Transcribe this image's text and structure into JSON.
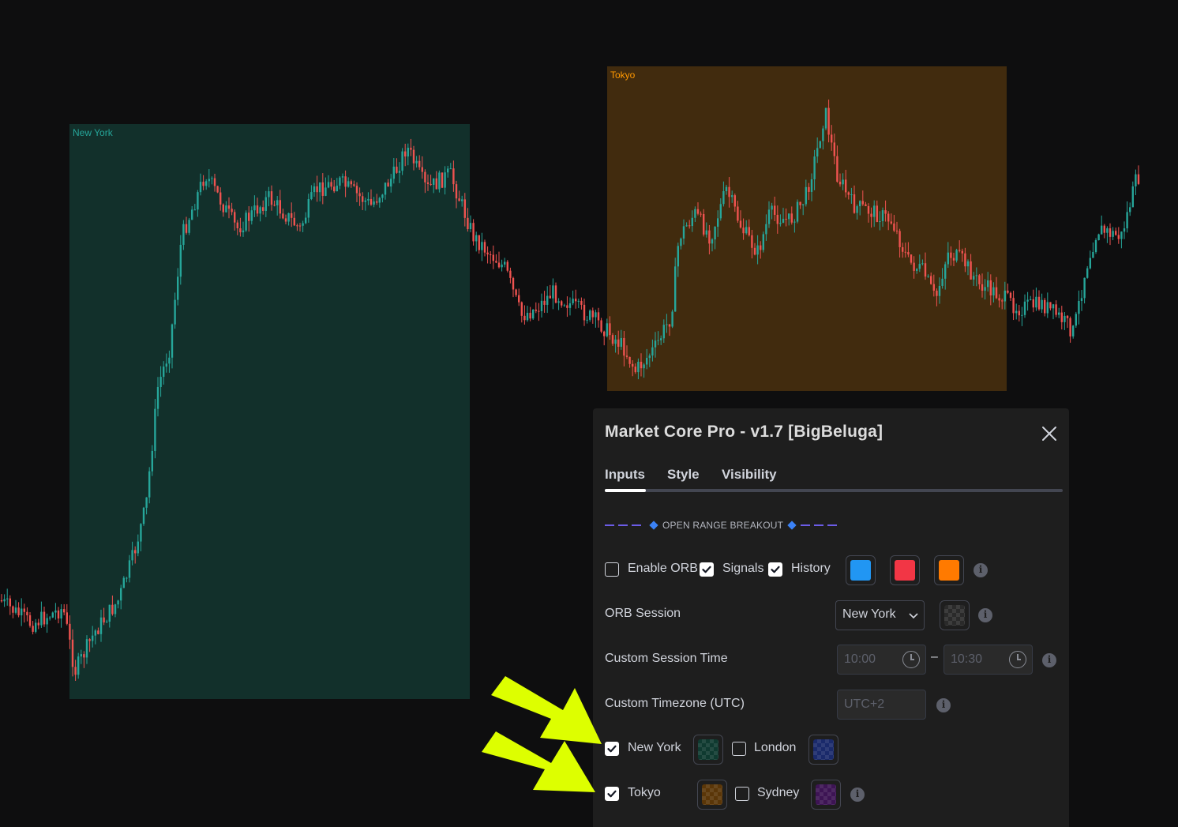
{
  "chart": {
    "sessions": [
      {
        "label": "New York",
        "color": "#26a69a"
      },
      {
        "label": "Tokyo",
        "color": "#ff9800"
      }
    ],
    "candle_up_color": "#26a69a",
    "candle_down_color": "#ef5350"
  },
  "dialog": {
    "title": "Market Core Pro - v1.7 [BigBeluga]",
    "tabs": [
      {
        "label": "Inputs",
        "active": true
      },
      {
        "label": "Style",
        "active": false
      },
      {
        "label": "Visibility",
        "active": false
      }
    ],
    "section_header": "OPEN RANGE BREAKOUT",
    "orb_row": {
      "enable_orb": {
        "label": "Enable ORB",
        "checked": false
      },
      "signals": {
        "label": "Signals",
        "checked": true
      },
      "history": {
        "label": "History",
        "checked": true
      },
      "colors": [
        "#2196f3",
        "#f23645",
        "#ff7a00"
      ]
    },
    "orb_session": {
      "label": "ORB Session",
      "selected": "New York"
    },
    "custom_session_time": {
      "label": "Custom Session Time",
      "start": "10:00",
      "separator": "–",
      "end": "10:30"
    },
    "custom_timezone": {
      "label": "Custom Timezone (UTC)",
      "placeholder": "UTC+2"
    },
    "sessions": [
      {
        "label": "New York",
        "checked": true,
        "color": "#0f3a30"
      },
      {
        "label": "London",
        "checked": false,
        "color": "#1a2a6b"
      },
      {
        "label": "Tokyo",
        "checked": true,
        "color": "#5a3608"
      },
      {
        "label": "Sydney",
        "checked": false,
        "color": "#3d1454"
      }
    ]
  },
  "annotation": {
    "arrow_color": "#ddff00"
  }
}
